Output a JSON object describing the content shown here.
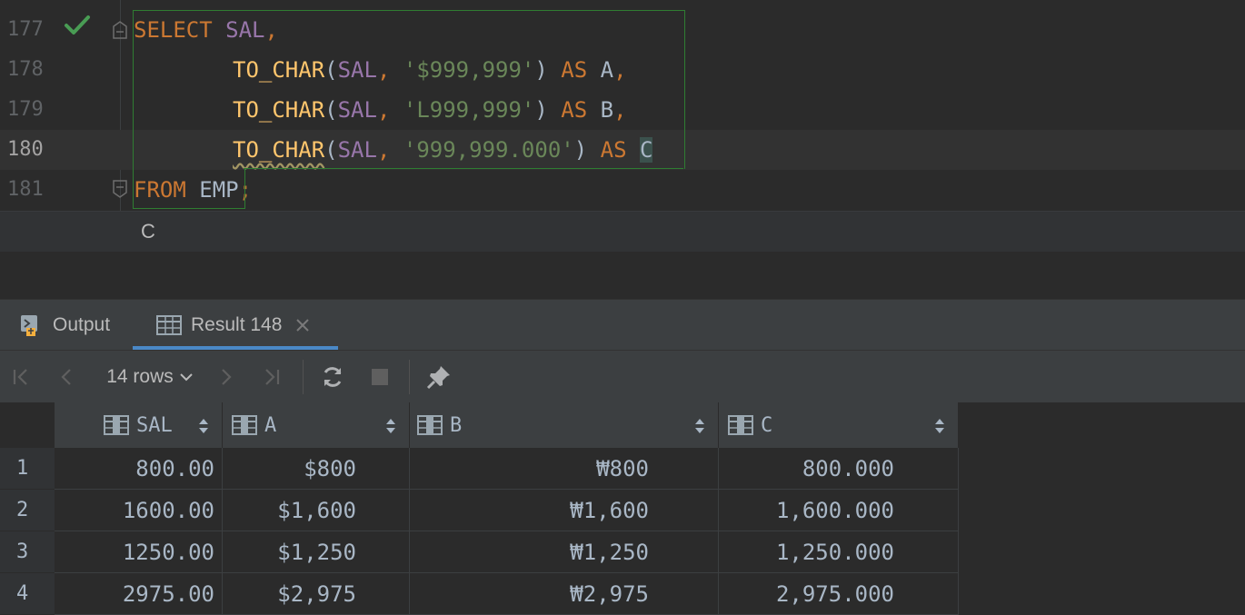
{
  "editor": {
    "lines": [
      {
        "num": "177"
      },
      {
        "num": "178"
      },
      {
        "num": "179"
      },
      {
        "num": "180"
      },
      {
        "num": "181"
      }
    ],
    "code": {
      "l177_select": "SELECT",
      "l177_sal": "SAL",
      "l178_fn": "TO_CHAR",
      "l178_arg": "SAL",
      "l178_fmt": "'$999,999'",
      "l178_as": "AS",
      "l178_alias": "A",
      "l179_fn": "TO_CHAR",
      "l179_arg": "SAL",
      "l179_fmt": "'L999,999'",
      "l179_as": "AS",
      "l179_alias": "B",
      "l180_fn": "TO_CHAR",
      "l180_arg": "SAL",
      "l180_fmt": "'999,999.000'",
      "l180_as": "AS",
      "l180_alias": "C",
      "l181_from": "FROM",
      "l181_table": "EMP"
    },
    "hint": "C"
  },
  "tabs": {
    "output_label": "Output",
    "result_label": "Result 148"
  },
  "toolbar": {
    "rows_label": "14 rows"
  },
  "grid": {
    "columns": [
      "SAL",
      "A",
      "B",
      "C"
    ],
    "rows": [
      {
        "n": "1",
        "sal": "800.00",
        "a": "$800",
        "b": "₩800",
        "c": "800.000"
      },
      {
        "n": "2",
        "sal": "1600.00",
        "a": "$1,600",
        "b": "₩1,600",
        "c": "1,600.000"
      },
      {
        "n": "3",
        "sal": "1250.00",
        "a": "$1,250",
        "b": "₩1,250",
        "c": "1,250.000"
      },
      {
        "n": "4",
        "sal": "2975.00",
        "a": "$2,975",
        "b": "₩2,975",
        "c": "2,975.000"
      }
    ]
  },
  "colors": {
    "keyword": "#cc7832",
    "column": "#9876aa",
    "function": "#ffc66d",
    "string": "#6a8759",
    "selection_box": "#2f7d32",
    "tab_underline": "#4a88c7"
  }
}
